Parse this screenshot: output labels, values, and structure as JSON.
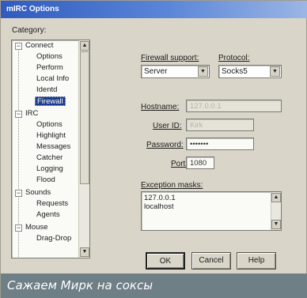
{
  "window": {
    "title": "mIRC Options"
  },
  "category": {
    "label": "Category:",
    "tree": [
      {
        "label": "Connect",
        "expander": "−"
      },
      {
        "label": "Options"
      },
      {
        "label": "Perform"
      },
      {
        "label": "Local Info"
      },
      {
        "label": "Identd"
      },
      {
        "label": "Firewall",
        "selected": true
      },
      {
        "label": "IRC",
        "expander": "−"
      },
      {
        "label": "Options"
      },
      {
        "label": "Highlight"
      },
      {
        "label": "Messages"
      },
      {
        "label": "Catcher"
      },
      {
        "label": "Logging"
      },
      {
        "label": "Flood"
      },
      {
        "label": "Sounds",
        "expander": "−"
      },
      {
        "label": "Requests"
      },
      {
        "label": "Agents"
      },
      {
        "label": "Mouse",
        "expander": "−"
      },
      {
        "label": "Drag-Drop"
      }
    ]
  },
  "firewall": {
    "support_label": "Firewall support:",
    "support_value": "Server",
    "protocol_label": "Protocol:",
    "protocol_value": "Socks5",
    "hostname_label": "Hostname:",
    "hostname_value": "127.0.0.1",
    "userid_label": "User ID:",
    "userid_value": "Kirk",
    "password_label": "Password:",
    "password_value": "•••••••",
    "port_label": "Port:",
    "port_value": "1080"
  },
  "exceptions": {
    "label": "Exception masks:",
    "lines": [
      "127.0.0.1",
      "localhost"
    ]
  },
  "buttons": {
    "ok": "OK",
    "cancel": "Cancel",
    "help": "Help"
  },
  "caption": "Сажаем Мирк на соксы",
  "colors": {
    "title_bar": "#2f5bbf",
    "selection": "#1e3c8c",
    "caption_bg": "#6e7f86"
  },
  "icons": {
    "scroll_up": "▲",
    "scroll_down": "▼",
    "dropdown": "▼"
  }
}
